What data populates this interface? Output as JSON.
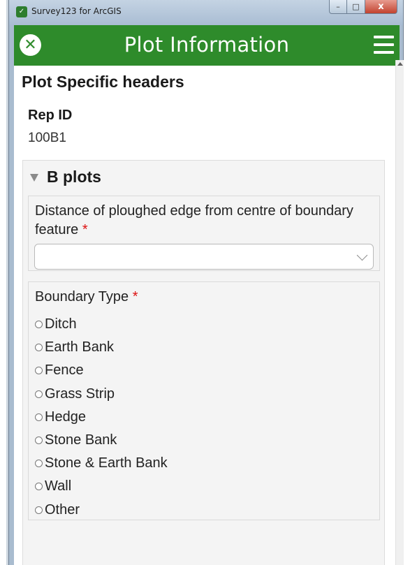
{
  "window": {
    "title": "Survey123 for ArcGIS",
    "buttons": {
      "minimize": "–",
      "maximize": "□",
      "close": "x"
    }
  },
  "header": {
    "title": "Plot Information"
  },
  "form": {
    "section_title": "Plot Specific headers",
    "rep_id": {
      "label": "Rep ID",
      "value": "100B1"
    },
    "group": {
      "title": "B plots",
      "distance_question": {
        "label": "Distance of ploughed edge from centre of boundary feature",
        "required_mark": "*",
        "selected_value": ""
      },
      "boundary_question": {
        "label": "Boundary Type",
        "required_mark": "*",
        "options": [
          "Ditch",
          "Earth Bank",
          "Fence",
          "Grass Strip",
          "Hedge",
          "Stone Bank",
          "Stone & Earth Bank",
          "Wall",
          "Other"
        ]
      }
    }
  },
  "colors": {
    "header_green": "#2e8b2b",
    "required_red": "#d11111",
    "group_bg": "#f4f4f4"
  },
  "icons": {
    "app": "survey123-icon",
    "close": "close-circle-icon",
    "menu": "hamburger-menu-icon",
    "collapse": "triangle-down-icon",
    "dropdown": "chevron-down-icon"
  }
}
